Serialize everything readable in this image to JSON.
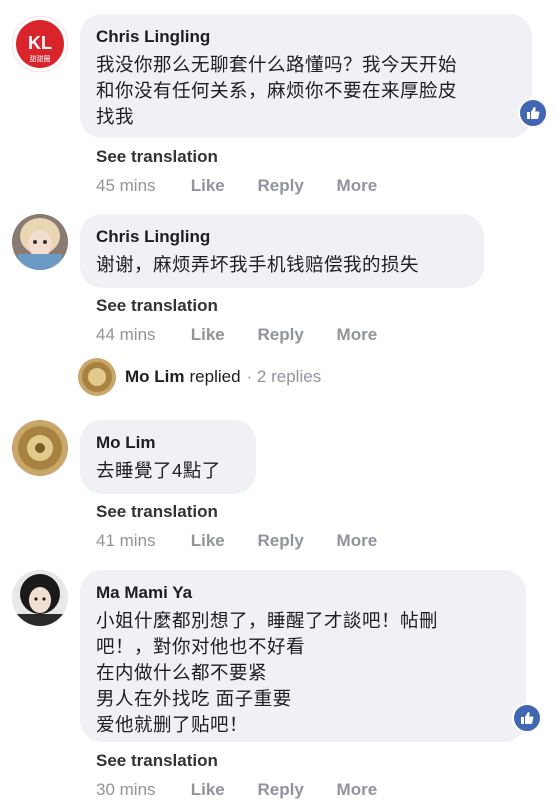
{
  "comments": [
    {
      "author": "Chris Lingling",
      "text": "我没你那么无聊套什么路懂吗？我今天开始\n和你没有任何关系，麻烦你不要在来厚脸皮\n找我",
      "see_translation": "See translation",
      "time": "45 mins",
      "like": "Like",
      "reply": "Reply",
      "more": "More",
      "avatar_text": "KL",
      "avatar_subtext": "甜甜圈"
    },
    {
      "author": "Chris Lingling",
      "text": "谢谢，麻烦弄坏我手机钱赔偿我的损失",
      "see_translation": "See translation",
      "time": "44 mins",
      "like": "Like",
      "reply": "Reply",
      "more": "More"
    },
    {
      "author": "Mo Lim",
      "text": "去睡覺了4點了",
      "see_translation": "See translation",
      "time": "41 mins",
      "like": "Like",
      "reply": "Reply",
      "more": "More"
    },
    {
      "author": "Ma Mami Ya",
      "text": "小姐什麼都別想了，睡醒了才談吧！帖刪\n吧！，對你对他也不好看\n在内做什么都不要紧\n男人在外找吃 面子重要\n爱他就删了贴吧！",
      "see_translation": "See translation",
      "time": "30 mins",
      "like": "Like",
      "reply": "Reply",
      "more": "More"
    }
  ],
  "replies_summary": {
    "name": "Mo Lim",
    "replied": "replied",
    "count": "· 2 replies"
  },
  "colors": {
    "bubble": "#eff1f4",
    "like_badge": "#4267b2",
    "meta": "#90949c",
    "text": "#1c1e21"
  },
  "icons": {
    "reaction": "thumbs-up-icon"
  }
}
